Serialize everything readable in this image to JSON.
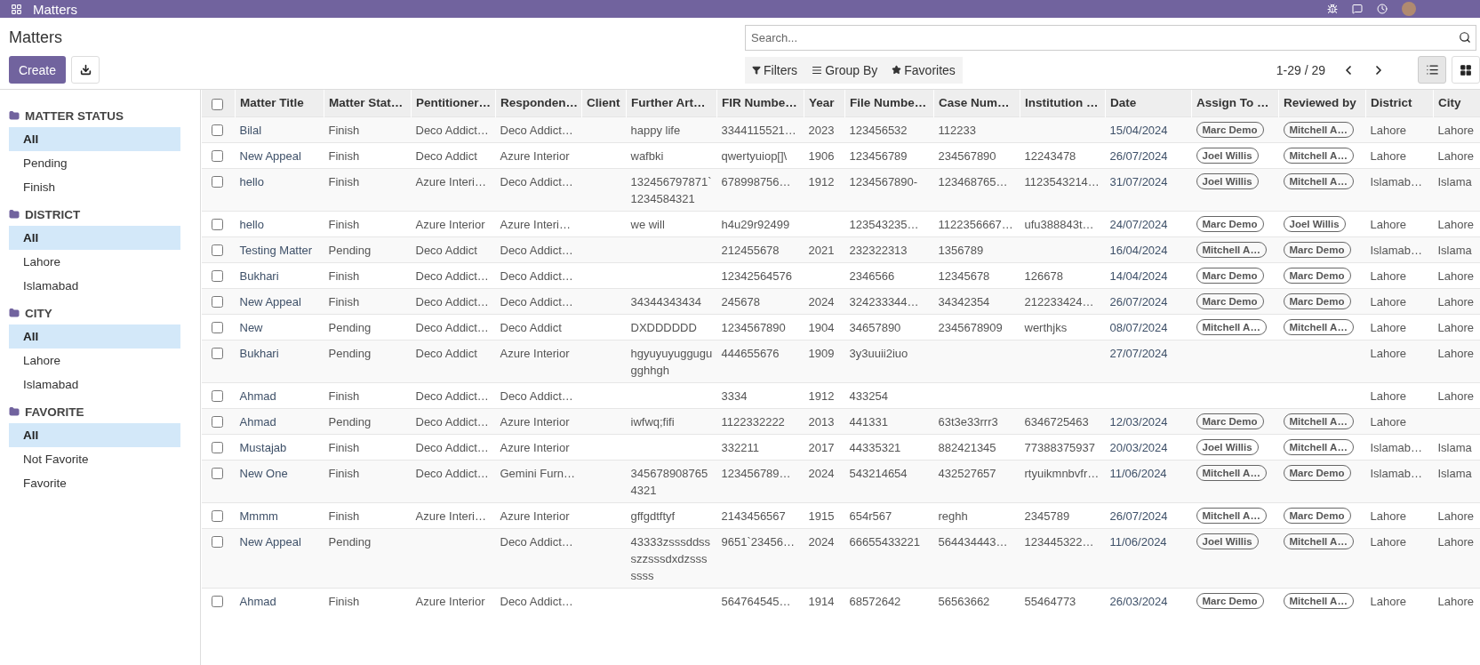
{
  "navbar": {
    "app": "Matters"
  },
  "page": {
    "title": "Matters",
    "create": "Create"
  },
  "search": {
    "placeholder": "Search..."
  },
  "filters": [
    {
      "kind": "filter",
      "label": "Filters"
    },
    {
      "kind": "group",
      "label": "Group By"
    },
    {
      "kind": "favorite",
      "label": "Favorites"
    }
  ],
  "pager": {
    "text": "1-29 / 29"
  },
  "views": [
    {
      "kind": "list",
      "selected": true
    },
    {
      "kind": "kanban",
      "selected": false
    }
  ],
  "sidebar": [
    {
      "title": "MATTER STATUS",
      "items": [
        {
          "label": "All",
          "selected": true
        },
        {
          "label": "Pending",
          "selected": false
        },
        {
          "label": "Finish",
          "selected": false
        }
      ]
    },
    {
      "title": "DISTRICT",
      "items": [
        {
          "label": "All",
          "selected": true
        },
        {
          "label": "Lahore",
          "selected": false
        },
        {
          "label": "Islamabad",
          "selected": false
        }
      ]
    },
    {
      "title": "CITY",
      "items": [
        {
          "label": "All",
          "selected": true
        },
        {
          "label": "Lahore",
          "selected": false
        },
        {
          "label": "Islamabad",
          "selected": false
        }
      ]
    },
    {
      "title": "FAVORITE",
      "items": [
        {
          "label": "All",
          "selected": true
        },
        {
          "label": "Not Favorite",
          "selected": false
        },
        {
          "label": "Favorite",
          "selected": false
        }
      ]
    }
  ],
  "table": {
    "all_checked": false,
    "columns": [
      "Matter Title",
      "Matter Stat…",
      "Pentitioner…",
      "Responden…",
      "Client",
      "Further Art…",
      "FIR Numbe…",
      "Year",
      "File Numbe…",
      "Case Num…",
      "Institution …",
      "Date",
      "Assign To …",
      "Reviewed by",
      "District",
      "City"
    ],
    "rows": [
      {
        "checked": false,
        "title": "Bilal",
        "status": "Finish",
        "petitioner": "Deco Addict…",
        "respondent": "Deco Addict…",
        "further": "happy life",
        "fir": "3344115521…",
        "year": "2023",
        "file": "123456532",
        "case": "112233",
        "date": "15/04/2024",
        "assign_to": "Marc Demo",
        "reviewed_by": "Mitchell A…",
        "district": "Lahore",
        "city": "Lahore"
      },
      {
        "checked": false,
        "title": "New Appeal",
        "status": "Finish",
        "petitioner": "Deco Addict",
        "respondent": "Azure Interior",
        "further": "wafbki",
        "fir": "qwertyuiop[]\\",
        "year": "1906",
        "file": "123456789",
        "case": "234567890",
        "institution": "12243478",
        "date": "26/07/2024",
        "assign_to": "Joel Willis",
        "reviewed_by": "Mitchell A…",
        "district": "Lahore",
        "city": "Lahore"
      },
      {
        "checked": false,
        "title": "hello",
        "status": "Finish",
        "petitioner": "Azure Interi…",
        "respondent": "Deco Addict…",
        "further": "132456797871`1234584321",
        "fir": "678998756…",
        "year": "1912",
        "file": "1234567890-",
        "case": "123468765…",
        "institution": "1123543214…",
        "date": "31/07/2024",
        "assign_to": "Joel Willis",
        "reviewed_by": "Mitchell A…",
        "district": "Islamab…",
        "city": "Islama"
      },
      {
        "checked": false,
        "title": "hello",
        "status": "Finish",
        "petitioner": "Azure Interior",
        "respondent": "Azure Interi…",
        "further": "we will",
        "fir": "h4u29r92499",
        "file": "123543235…",
        "case": "1122356667…",
        "institution": "ufu388843t…",
        "date": "24/07/2024",
        "assign_to": "Marc Demo",
        "reviewed_by": "Joel Willis",
        "district": "Lahore",
        "city": "Lahore"
      },
      {
        "checked": false,
        "title": "Testing Matter",
        "status": "Pending",
        "petitioner": "Deco Addict",
        "respondent": "Deco Addict…",
        "fir": "212455678",
        "year": "2021",
        "file": "232322313",
        "case": "1356789",
        "date": "16/04/2024",
        "assign_to": "Mitchell A…",
        "reviewed_by": "Marc Demo",
        "district": "Islamab…",
        "city": "Islama"
      },
      {
        "checked": false,
        "title": "Bukhari",
        "status": "Finish",
        "petitioner": "Deco Addict…",
        "respondent": "Deco Addict…",
        "fir": "12342564576",
        "file": "2346566",
        "case": "12345678",
        "institution": "126678",
        "date": "14/04/2024",
        "assign_to": "Marc Demo",
        "reviewed_by": "Marc Demo",
        "district": "Lahore",
        "city": "Lahore"
      },
      {
        "checked": false,
        "title": "New Appeal",
        "status": "Finish",
        "petitioner": "Deco Addict…",
        "respondent": "Deco Addict…",
        "further": "34344343434",
        "fir": "245678",
        "year": "2024",
        "file": "324233344…",
        "case": "34342354",
        "institution": "212233424…",
        "date": "26/07/2024",
        "assign_to": "Marc Demo",
        "reviewed_by": "Marc Demo",
        "district": "Lahore",
        "city": "Lahore"
      },
      {
        "checked": false,
        "title": "New",
        "status": "Pending",
        "petitioner": "Deco Addict…",
        "respondent": "Deco Addict",
        "further": "DXDDDDDD",
        "fir": "1234567890",
        "year": "1904",
        "file": "34657890",
        "case": "2345678909",
        "institution": "werthjks",
        "date": "08/07/2024",
        "assign_to": "Mitchell A…",
        "reviewed_by": "Mitchell A…",
        "district": "Lahore",
        "city": "Lahore"
      },
      {
        "checked": false,
        "title": "Bukhari",
        "status": "Pending",
        "petitioner": "Deco Addict",
        "respondent": "Azure Interior",
        "further": "hgyuyuyuggugugghhgh",
        "fir": "444655676",
        "year": "1909",
        "file": "3y3uuii2iuo",
        "date": "27/07/2024",
        "district": "Lahore",
        "city": "Lahore"
      },
      {
        "checked": false,
        "title": "Ahmad",
        "status": "Finish",
        "petitioner": "Deco Addict…",
        "respondent": "Deco Addict…",
        "fir": "3334",
        "year": "1912",
        "file": "433254",
        "district": "Lahore",
        "city": "Lahore"
      },
      {
        "checked": false,
        "title": "Ahmad",
        "status": "Pending",
        "petitioner": "Deco Addict…",
        "respondent": "Azure Interior",
        "further": "iwfwq;fifi",
        "fir": "1122332222",
        "year": "2013",
        "file": "441331",
        "case": "63t3e33rrr3",
        "institution": "6346725463",
        "date": "12/03/2024",
        "assign_to": "Marc Demo",
        "reviewed_by": "Mitchell A…",
        "district": "Lahore"
      },
      {
        "checked": false,
        "title": "Mustajab",
        "status": "Finish",
        "petitioner": "Deco Addict…",
        "respondent": "Azure Interior",
        "fir": "332211",
        "year": "2017",
        "file": "44335321",
        "case": "882421345",
        "institution": "77388375937",
        "date": "20/03/2024",
        "assign_to": "Joel Willis",
        "reviewed_by": "Mitchell A…",
        "district": "Islamab…",
        "city": "Islama"
      },
      {
        "checked": false,
        "title": "New One",
        "status": "Finish",
        "petitioner": "Deco Addict…",
        "respondent": "Gemini Furn…",
        "further": "3456789087654321",
        "fir": "123456789…",
        "year": "2024",
        "file": "543214654",
        "case": "432527657",
        "institution": "rtyuikmnbvfr…",
        "date": "11/06/2024",
        "assign_to": "Mitchell A…",
        "reviewed_by": "Marc Demo",
        "district": "Islamab…",
        "city": "Islama"
      },
      {
        "checked": false,
        "title": "Mmmm",
        "status": "Finish",
        "petitioner": "Azure Interi…",
        "respondent": "Azure Interior",
        "further": "gffgdtftyf",
        "fir": "2143456567",
        "year": "1915",
        "file": "654r567",
        "case": "reghh",
        "institution": "2345789",
        "date": "26/07/2024",
        "assign_to": "Mitchell A…",
        "reviewed_by": "Marc Demo",
        "district": "Lahore",
        "city": "Lahore"
      },
      {
        "checked": false,
        "title": "New Appeal",
        "status": "Pending",
        "respondent": "Deco Addict…",
        "further": "43333zsssddssszzsssdxdzsssssss",
        "fir": "9651`23456…",
        "year": "2024",
        "file": "66655433221",
        "case": "564434443…",
        "institution": "123445322…",
        "date": "11/06/2024",
        "assign_to": "Joel Willis",
        "reviewed_by": "Mitchell A…",
        "district": "Lahore",
        "city": "Lahore"
      },
      {
        "checked": false,
        "title": "Ahmad",
        "status": "Finish",
        "petitioner": "Azure Interior",
        "respondent": "Deco Addict…",
        "fir": "564764545…",
        "year": "1914",
        "file": "68572642",
        "case": "56563662",
        "institution": "55464773",
        "date": "26/03/2024",
        "assign_to": "Marc Demo",
        "reviewed_by": "Mitchell A…",
        "district": "Lahore",
        "city": "Lahore"
      }
    ]
  }
}
